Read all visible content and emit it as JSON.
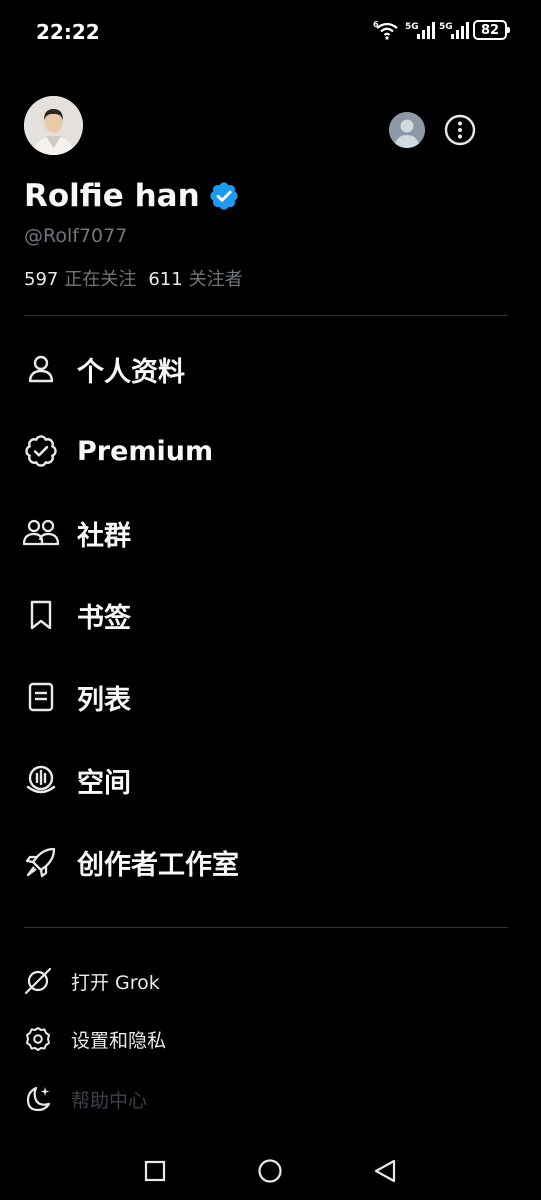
{
  "status_bar": {
    "time": "22:22",
    "battery": "82",
    "network_1": "5G",
    "network_2": "5G",
    "wifi_label": "6"
  },
  "profile": {
    "display_name": "Rolfie han",
    "handle": "@Rolf7077",
    "following_count": "597",
    "following_label": "正在关注",
    "followers_count": "611",
    "followers_label": "关注者",
    "verified": true
  },
  "menu": [
    {
      "label": "个人资料",
      "icon": "person-icon"
    },
    {
      "label": "Premium",
      "icon": "premium-badge-icon"
    },
    {
      "label": "社群",
      "icon": "communities-icon"
    },
    {
      "label": "书签",
      "icon": "bookmark-icon"
    },
    {
      "label": "列表",
      "icon": "list-icon"
    },
    {
      "label": "空间",
      "icon": "spaces-icon"
    },
    {
      "label": "创作者工作室",
      "icon": "rocket-icon"
    }
  ],
  "secondary": [
    {
      "label": "打开 Grok",
      "icon": "grok-icon"
    },
    {
      "label": "设置和隐私",
      "icon": "gear-icon"
    },
    {
      "label": "帮助中心",
      "icon": "moon-sparkle-icon"
    }
  ],
  "colors": {
    "background": "#000000",
    "verified_blue": "#1d9bf0",
    "muted_text": "#71767b",
    "divider": "#2f3336"
  }
}
